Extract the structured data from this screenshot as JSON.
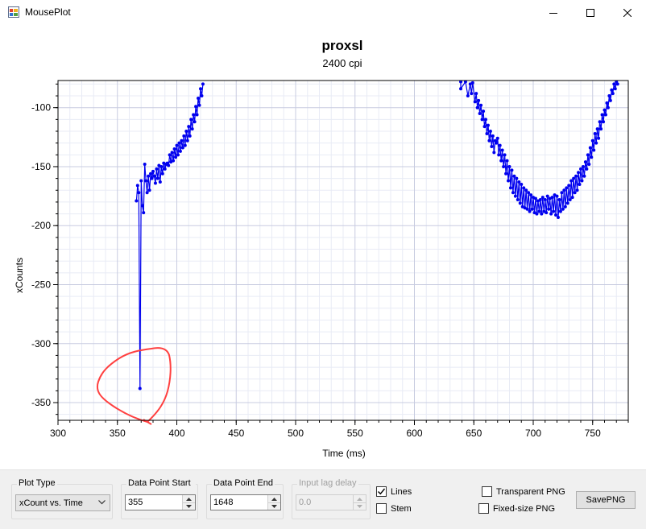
{
  "window": {
    "title": "MousePlot"
  },
  "controls": {
    "plot_type": {
      "label": "Plot Type",
      "value": "xCount vs. Time"
    },
    "data_point_start": {
      "label": "Data Point Start",
      "value": "355"
    },
    "data_point_end": {
      "label": "Data Point End",
      "value": "1648"
    },
    "input_lag_delay": {
      "label": "Input lag delay",
      "value": "0.0"
    },
    "lines": {
      "label": "Lines",
      "checked": true
    },
    "stem": {
      "label": "Stem",
      "checked": false
    },
    "transparent_png": {
      "label": "Transparent PNG",
      "checked": false
    },
    "fixed_size_png": {
      "label": "Fixed-size PNG",
      "checked": false
    },
    "save_png": {
      "label": "SavePNG"
    }
  },
  "colors": {
    "series": "#0000ee",
    "annotation": "#ff4040",
    "major_grid": "#c8cce0",
    "minor_grid": "#e8ebf5"
  },
  "chart_data": {
    "type": "line",
    "title": "proxsl",
    "subtitle": "2400 cpi",
    "xlabel": "Time (ms)",
    "ylabel": "xCounts",
    "xlim": [
      300,
      780
    ],
    "ylim": [
      -365,
      -77
    ],
    "xticks": [
      300,
      350,
      400,
      450,
      500,
      550,
      600,
      650,
      700,
      750
    ],
    "yticks": [
      -100,
      -150,
      -200,
      -250,
      -300,
      -350
    ],
    "grid": true,
    "series": [
      {
        "name": "",
        "segments": [
          [
            [
              366,
              -179
            ],
            [
              367,
              -166
            ],
            [
              368,
              -172
            ],
            [
              369,
              -338
            ],
            [
              370,
              -162
            ],
            [
              371,
              -183
            ],
            [
              372,
              -189
            ],
            [
              373,
              -148
            ],
            [
              374,
              -162
            ],
            [
              375,
              -172
            ],
            [
              376,
              -158
            ],
            [
              377,
              -170
            ],
            [
              378,
              -156
            ],
            [
              379,
              -160
            ],
            [
              380,
              -154
            ],
            [
              381,
              -158
            ],
            [
              382,
              -164
            ],
            [
              383,
              -152
            ],
            [
              384,
              -160
            ],
            [
              385,
              -149
            ],
            [
              386,
              -163
            ],
            [
              387,
              -150
            ],
            [
              388,
              -156
            ],
            [
              389,
              -147
            ],
            [
              390,
              -152
            ],
            [
              391,
              -148
            ],
            [
              392,
              -147
            ],
            [
              393,
              -149
            ],
            [
              394,
              -140
            ],
            [
              395,
              -146
            ],
            [
              396,
              -138
            ],
            [
              397,
              -145
            ],
            [
              398,
              -135
            ],
            [
              399,
              -142
            ],
            [
              400,
              -132
            ],
            [
              401,
              -140
            ],
            [
              402,
              -130
            ],
            [
              403,
              -137
            ],
            [
              404,
              -128
            ],
            [
              405,
              -134
            ],
            [
              406,
              -124
            ],
            [
              407,
              -132
            ],
            [
              408,
              -120
            ],
            [
              409,
              -128
            ],
            [
              410,
              -116
            ],
            [
              411,
              -124
            ],
            [
              412,
              -110
            ],
            [
              413,
              -118
            ],
            [
              414,
              -106
            ],
            [
              415,
              -112
            ],
            [
              416,
              -99
            ],
            [
              417,
              -106
            ],
            [
              418,
              -92
            ],
            [
              419,
              -98
            ],
            [
              420,
              -84
            ],
            [
              421,
              -90
            ],
            [
              422,
              -80
            ]
          ],
          [
            [
              639,
              -78
            ],
            [
              639,
              -84
            ],
            [
              643,
              -78
            ],
            [
              645,
              -90
            ],
            [
              647,
              -80
            ],
            [
              648,
              -88
            ],
            [
              649,
              -79
            ],
            [
              651,
              -95
            ],
            [
              652,
              -88
            ],
            [
              653,
              -100
            ],
            [
              654,
              -94
            ],
            [
              655,
              -105
            ],
            [
              656,
              -98
            ],
            [
              657,
              -110
            ],
            [
              658,
              -103
            ],
            [
              659,
              -116
            ],
            [
              660,
              -110
            ],
            [
              661,
              -122
            ],
            [
              662,
              -115
            ],
            [
              663,
              -128
            ],
            [
              664,
              -120
            ],
            [
              665,
              -133
            ],
            [
              666,
              -124
            ],
            [
              667,
              -138
            ],
            [
              668,
              -128
            ],
            [
              669,
              -130
            ],
            [
              670,
              -126
            ],
            [
              671,
              -140
            ],
            [
              672,
              -132
            ],
            [
              673,
              -145
            ],
            [
              674,
              -136
            ],
            [
              675,
              -150
            ],
            [
              676,
              -140
            ],
            [
              677,
              -156
            ],
            [
              678,
              -145
            ],
            [
              679,
              -162
            ],
            [
              680,
              -150
            ],
            [
              681,
              -168
            ],
            [
              682,
              -153
            ],
            [
              683,
              -172
            ],
            [
              684,
              -158
            ],
            [
              685,
              -175
            ],
            [
              686,
              -160
            ],
            [
              687,
              -178
            ],
            [
              688,
              -163
            ],
            [
              689,
              -181
            ],
            [
              690,
              -165
            ],
            [
              691,
              -184
            ],
            [
              692,
              -168
            ],
            [
              693,
              -185
            ],
            [
              694,
              -170
            ],
            [
              695,
              -186
            ],
            [
              696,
              -172
            ],
            [
              697,
              -188
            ],
            [
              698,
              -174
            ],
            [
              699,
              -186
            ],
            [
              700,
              -176
            ],
            [
              701,
              -189
            ],
            [
              702,
              -177
            ],
            [
              703,
              -190
            ],
            [
              704,
              -179
            ],
            [
              705,
              -188
            ],
            [
              706,
              -178
            ],
            [
              707,
              -190
            ],
            [
              708,
              -176
            ],
            [
              709,
              -188
            ],
            [
              710,
              -178
            ],
            [
              711,
              -189
            ],
            [
              712,
              -175
            ],
            [
              713,
              -186
            ],
            [
              714,
              -177
            ],
            [
              715,
              -190
            ],
            [
              716,
              -176
            ],
            [
              717,
              -188
            ],
            [
              718,
              -174
            ],
            [
              719,
              -191
            ],
            [
              720,
              -175
            ],
            [
              721,
              -193
            ],
            [
              722,
              -178
            ],
            [
              723,
              -188
            ],
            [
              724,
              -172
            ],
            [
              725,
              -186
            ],
            [
              726,
              -170
            ],
            [
              727,
              -184
            ],
            [
              728,
              -168
            ],
            [
              729,
              -181
            ],
            [
              730,
              -166
            ],
            [
              731,
              -178
            ],
            [
              732,
              -162
            ],
            [
              733,
              -176
            ],
            [
              734,
              -160
            ],
            [
              735,
              -172
            ],
            [
              736,
              -158
            ],
            [
              737,
              -170
            ],
            [
              738,
              -155
            ],
            [
              739,
              -165
            ],
            [
              740,
              -152
            ],
            [
              741,
              -162
            ],
            [
              742,
              -150
            ],
            [
              743,
              -158
            ],
            [
              744,
              -146
            ],
            [
              745,
              -152
            ],
            [
              746,
              -140
            ],
            [
              747,
              -148
            ],
            [
              748,
              -134
            ],
            [
              749,
              -142
            ],
            [
              750,
              -128
            ],
            [
              751,
              -136
            ],
            [
              752,
              -122
            ],
            [
              753,
              -130
            ],
            [
              754,
              -118
            ],
            [
              755,
              -126
            ],
            [
              756,
              -112
            ],
            [
              757,
              -118
            ],
            [
              758,
              -106
            ],
            [
              759,
              -112
            ],
            [
              760,
              -102
            ],
            [
              761,
              -106
            ],
            [
              762,
              -96
            ],
            [
              763,
              -100
            ],
            [
              764,
              -90
            ],
            [
              765,
              -94
            ],
            [
              766,
              -85
            ],
            [
              767,
              -88
            ],
            [
              768,
              -80
            ],
            [
              769,
              -84
            ],
            [
              770,
              -78
            ],
            [
              771,
              -80
            ]
          ]
        ]
      }
    ]
  }
}
